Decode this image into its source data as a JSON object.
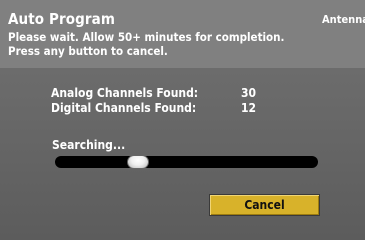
{
  "dialog": {
    "title": "Auto Program",
    "source": "Antenna",
    "instruction_line1": "Please wait. Allow 50+ minutes for completion.",
    "instruction_line2": "Press any button to cancel."
  },
  "stats": {
    "analog_label": "Analog Channels Found:",
    "analog_value": "30",
    "digital_label": "Digital Channels Found:",
    "digital_value": "12"
  },
  "progress": {
    "status_text": "Searching...",
    "position_fraction": 0.3
  },
  "buttons": {
    "cancel_label": "Cancel"
  },
  "colors": {
    "header_bg": "#808080",
    "panel_bg": "#666666",
    "button_bg": "#d8b22a",
    "text": "#ffffff"
  }
}
